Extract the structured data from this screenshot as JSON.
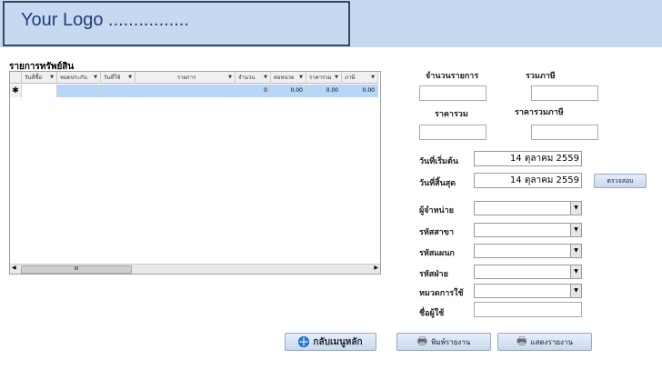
{
  "header": {
    "logo_text": "Your Logo ................"
  },
  "grid": {
    "title": "รายการทรัพย์สิน",
    "columns": [
      "วันที่ซื้อ",
      "หมดประกัน",
      "วันที่ใช้",
      "รายการ",
      "จำนวน",
      "ต่อหน่วย",
      "ราคารวม",
      "ภาษี"
    ],
    "new_row_marker": "✱",
    "new_row": [
      "",
      "",
      "",
      "",
      "0",
      "0.00",
      "0.00",
      "0.00"
    ],
    "scroll_thumb": "III"
  },
  "summary": {
    "count_label": "จำนวนรายการ",
    "count_value": "",
    "tax_total_label": "รวมภาษี",
    "tax_total_value": "",
    "price_total_label": "ราคารวม",
    "price_total_value": "",
    "price_tax_label": "ราคารวมภาษี",
    "price_tax_value": ""
  },
  "dates": {
    "start_label": "วันที่เริ่มต้น",
    "start_value": "14 ตุลาคม 2559",
    "end_label": "วันที่สิ้นสุด",
    "end_value": "14 ตุลาคม 2559",
    "check_button": "ตรวจสอบ"
  },
  "filters": {
    "vendor_label": "ผู้จำหน่าย",
    "branch_label": "รหัสสาขา",
    "dept_label": "รหัสแผนก",
    "division_label": "รหัสฝ่าย",
    "category_label": "หมวดการใช้",
    "user_label": "ชื่อผู้ใช้",
    "user_value": ""
  },
  "buttons": {
    "main_menu": "กลับเมนูหลัก",
    "print_report": "พิมพ์รายงาน",
    "show_report": "แสดงรายงาน"
  }
}
